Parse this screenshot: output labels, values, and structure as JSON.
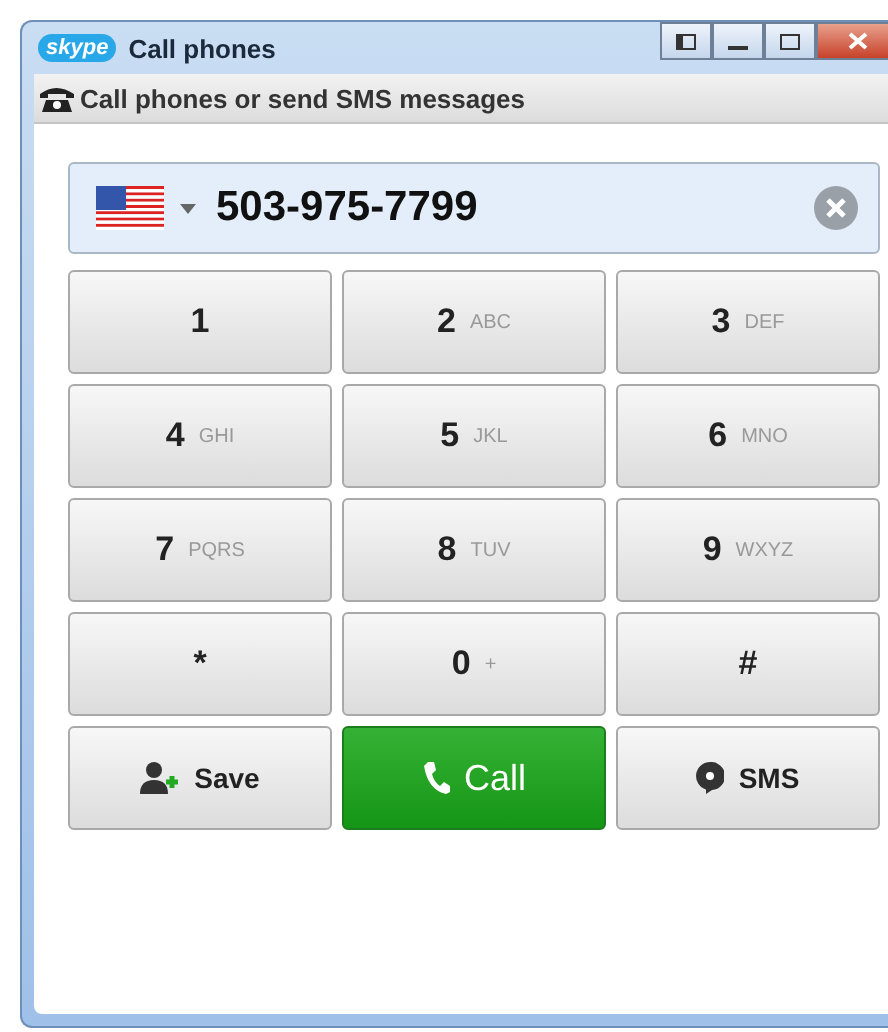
{
  "window": {
    "logo": "skype",
    "title": "Call phones"
  },
  "header": "Call phones or send SMS messages",
  "number_field": {
    "value": "503-975-7799"
  },
  "keypad": [
    {
      "digit": "1"
    },
    {
      "digit": "2",
      "letters": "ABC"
    },
    {
      "digit": "3",
      "letters": "DEF"
    },
    {
      "digit": "4",
      "letters": "GHI"
    },
    {
      "digit": "5",
      "letters": "JKL"
    },
    {
      "digit": "6",
      "letters": "MNO"
    },
    {
      "digit": "7",
      "letters": "PQRS"
    },
    {
      "digit": "8",
      "letters": "TUV"
    },
    {
      "digit": "9",
      "letters": "WXYZ"
    },
    {
      "digit": "*"
    },
    {
      "digit": "0",
      "letters": "+"
    },
    {
      "digit": "#"
    }
  ],
  "actions": [
    {
      "kind": "save",
      "label": "Save"
    },
    {
      "kind": "call",
      "label": "Call"
    },
    {
      "kind": "sms",
      "label": "SMS"
    }
  ]
}
